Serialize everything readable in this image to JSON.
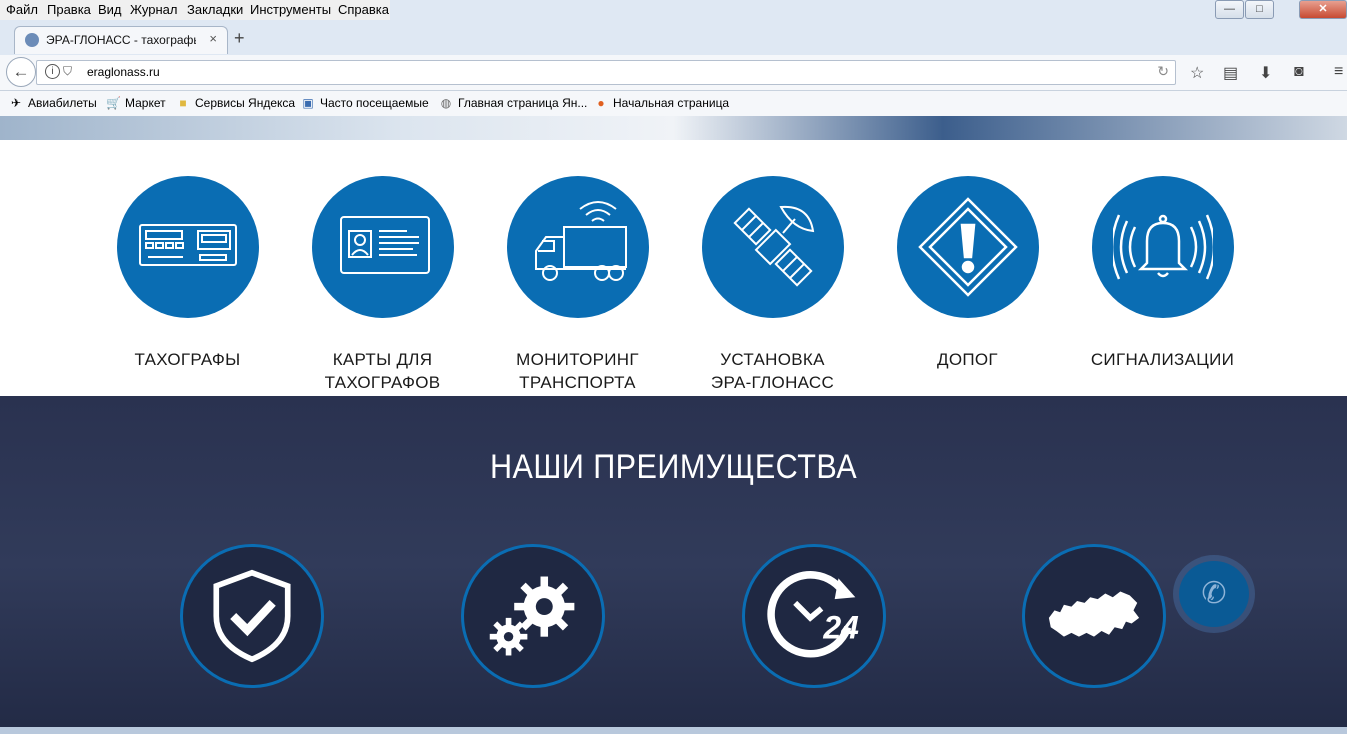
{
  "menu": [
    "Файл",
    "Правка",
    "Вид",
    "Журнал",
    "Закладки",
    "Инструменты",
    "Справка"
  ],
  "tab": {
    "title": "ЭРА-ГЛОНАСС - тахографы",
    "close": "×",
    "new": "+"
  },
  "address": {
    "url": "eraglonass.ru"
  },
  "bookmarks": [
    {
      "label": "Авиабилеты",
      "icon": "plane-icon"
    },
    {
      "label": "Маркет",
      "icon": "cart-icon"
    },
    {
      "label": "Сервисы Яндекса",
      "icon": "folder-icon"
    },
    {
      "label": "Часто посещаемые",
      "icon": "history-icon"
    },
    {
      "label": "Главная страница Ян...",
      "icon": "globe-icon"
    },
    {
      "label": "Начальная страница",
      "icon": "firefox-icon"
    }
  ],
  "services": [
    {
      "label": "ТАХОГРАФЫ",
      "icon": "tachograph-icon"
    },
    {
      "label": "КАРТЫ ДЛЯ\nТАХОГРАФОВ",
      "icon": "driver-card-icon"
    },
    {
      "label": "МОНИТОРИНГ\nТРАНСПОРТА",
      "icon": "truck-signal-icon"
    },
    {
      "label": "УСТАНОВКА\nЭРА-ГЛОНАСС",
      "icon": "satellite-icon"
    },
    {
      "label": "ДОПОГ",
      "icon": "hazard-sign-icon"
    },
    {
      "label": "СИГНАЛИЗАЦИИ",
      "icon": "alarm-bell-icon"
    }
  ],
  "advantages": {
    "title": "НАШИ ПРЕИМУЩЕСТВА",
    "items": [
      {
        "icon": "shield-check-icon"
      },
      {
        "icon": "gears-icon"
      },
      {
        "icon": "clock-24-icon",
        "badge": "24"
      },
      {
        "icon": "russia-map-icon"
      }
    ]
  },
  "colors": {
    "accent": "#0a6db3",
    "dark_bg": "#2a3250"
  }
}
